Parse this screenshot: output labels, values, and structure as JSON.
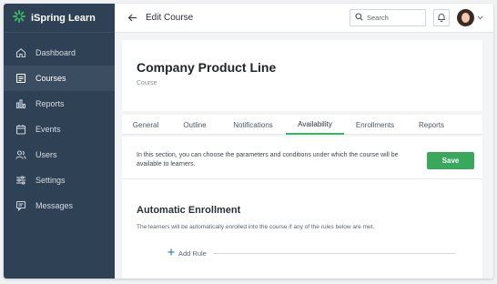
{
  "app": {
    "name": "iSpring Learn",
    "brand_color": "#39b566"
  },
  "sidebar": {
    "items": [
      {
        "label": "Dashboard",
        "icon": "home-icon",
        "active": false
      },
      {
        "label": "Courses",
        "icon": "courses-icon",
        "active": true
      },
      {
        "label": "Reports",
        "icon": "reports-icon",
        "active": false
      },
      {
        "label": "Events",
        "icon": "calendar-icon",
        "active": false
      },
      {
        "label": "Users",
        "icon": "users-icon",
        "active": false
      },
      {
        "label": "Settings",
        "icon": "settings-icon",
        "active": false
      },
      {
        "label": "Messages",
        "icon": "messages-icon",
        "active": false
      }
    ]
  },
  "topbar": {
    "title": "Edit Course",
    "search_placeholder": "Search"
  },
  "course": {
    "title": "Company Product Line",
    "subtitle": "Course"
  },
  "tabs": [
    {
      "label": "General"
    },
    {
      "label": "Outline"
    },
    {
      "label": "Notifications"
    },
    {
      "label": "Availability",
      "active": true
    },
    {
      "label": "Enrollments"
    },
    {
      "label": "Reports"
    }
  ],
  "panel": {
    "info_text": "In this section, you can choose the parameters and conditions under which the course will be available to learners.",
    "save_label": "Save",
    "section_title": "Automatic Enrollment",
    "section_desc": "The learners will be automatically enrolled into the course if any of the rules below are met.",
    "add_rule_label": "Add Rule"
  }
}
